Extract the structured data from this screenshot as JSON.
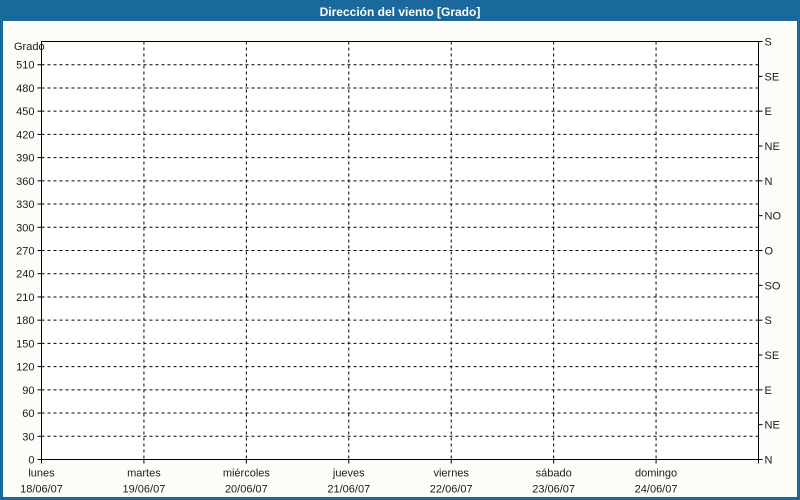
{
  "window": {
    "title": "Dirección del viento [Grado]",
    "title_bar_color": "#1A699C",
    "border_color": "#1A699C",
    "title_text_color": "#FFFFFF",
    "background_color": "#FCFDF8"
  },
  "chart_data": {
    "type": "line",
    "title": "Dirección del viento [Grado]",
    "no_data_plotted": true,
    "series": [],
    "y_left": {
      "label": "Grado",
      "range": [
        0,
        540
      ],
      "tick_step": 30,
      "ticks": [
        0,
        30,
        60,
        90,
        120,
        150,
        180,
        210,
        240,
        270,
        300,
        330,
        360,
        390,
        420,
        450,
        480,
        510
      ]
    },
    "y_right": {
      "tick_step_degrees": 45,
      "compass_cycle": [
        "N",
        "NE",
        "E",
        "SE",
        "S",
        "SO",
        "O",
        "NO"
      ],
      "ticks": [
        {
          "deg": 0,
          "label": "N"
        },
        {
          "deg": 45,
          "label": "NE"
        },
        {
          "deg": 90,
          "label": "E"
        },
        {
          "deg": 135,
          "label": "SE"
        },
        {
          "deg": 180,
          "label": "S"
        },
        {
          "deg": 225,
          "label": "SO"
        },
        {
          "deg": 270,
          "label": "O"
        },
        {
          "deg": 315,
          "label": "NO"
        },
        {
          "deg": 360,
          "label": "N"
        },
        {
          "deg": 405,
          "label": "NE"
        },
        {
          "deg": 450,
          "label": "E"
        },
        {
          "deg": 495,
          "label": "SE"
        },
        {
          "deg": 540,
          "label": "S"
        }
      ]
    },
    "x_axis": {
      "days": [
        {
          "name": "lunes",
          "date": "18/06/07"
        },
        {
          "name": "martes",
          "date": "19/06/07"
        },
        {
          "name": "miércoles",
          "date": "20/06/07"
        },
        {
          "name": "jueves",
          "date": "21/06/07"
        },
        {
          "name": "viernes",
          "date": "22/06/07"
        },
        {
          "name": "sábado",
          "date": "23/06/07"
        },
        {
          "name": "domingo",
          "date": "24/06/07"
        }
      ]
    },
    "grid": {
      "horizontal_style": "dashed",
      "vertical_style": "dashed",
      "line_color": "#000000",
      "plot_background": "#FFFFFF",
      "text_color": "#1b1b1b"
    }
  }
}
